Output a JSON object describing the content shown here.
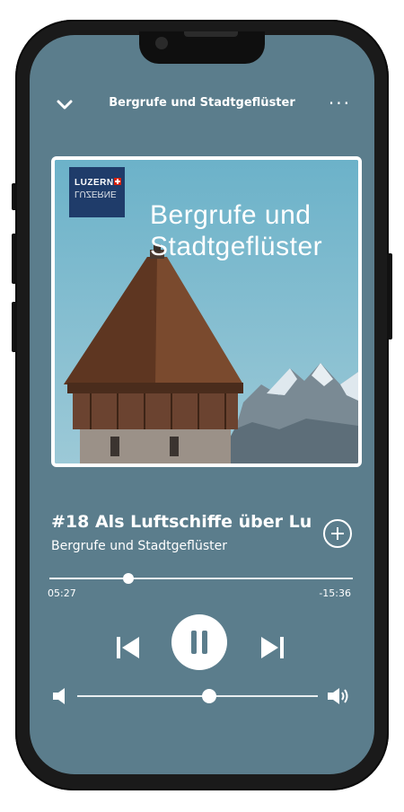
{
  "header": {
    "title": "Bergrufe und Stadtgeflüster",
    "more_label": "···"
  },
  "artwork": {
    "title_line1": "Bergrufe und",
    "title_line2": "Stadtgeflüster",
    "logo_line1": "LUZERN",
    "logo_line2": "LUZERNE"
  },
  "track": {
    "title": "#18 Als Luftschiffe über Lu",
    "subtitle": "Bergrufe und Stadtgeflüster"
  },
  "playback": {
    "elapsed": "05:27",
    "remaining": "-15:36",
    "progress_fraction": 0.26
  },
  "volume": {
    "level_fraction": 0.55
  },
  "icons": {
    "back": "chevron-down-icon",
    "more": "more-icon",
    "add": "plus-circle-icon",
    "prev": "skip-previous-icon",
    "play": "pause-icon",
    "next": "skip-next-icon",
    "vol_low": "volume-low-icon",
    "vol_high": "volume-high-icon"
  },
  "colors": {
    "background": "#5b7d8c",
    "accent": "#ffffff"
  }
}
